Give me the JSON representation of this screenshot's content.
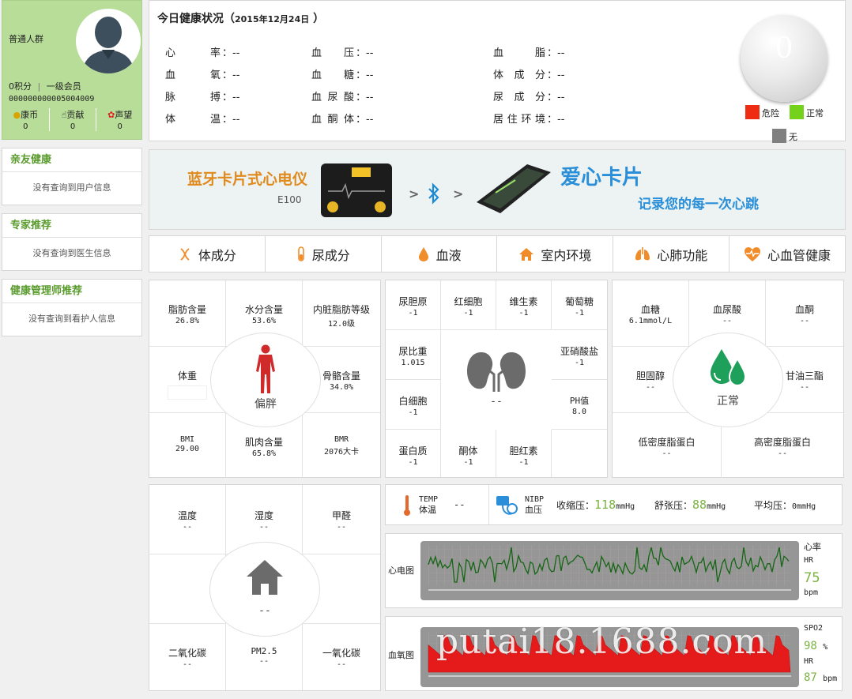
{
  "user": {
    "group": "普通人群",
    "points": "0积分",
    "level": "一级会员",
    "id": "000000000005004009",
    "stats": [
      {
        "label": "康币",
        "value": "0",
        "icon": "coin-icon"
      },
      {
        "label": "贡献",
        "value": "0",
        "icon": "hand-icon"
      },
      {
        "label": "声望",
        "value": "0",
        "icon": "ribbon-icon"
      }
    ]
  },
  "sidebar": [
    {
      "title": "亲友健康",
      "empty": "没有查询到用户信息"
    },
    {
      "title": "专家推荐",
      "empty": "没有查询到医生信息"
    },
    {
      "title": "健康管理师推荐",
      "empty": "没有查询到看护人信息"
    }
  ],
  "today": {
    "title": "今日健康状况（",
    "date": "2015年12月24日",
    "close": "）",
    "vitals": [
      {
        "label": "心率",
        "value": "--"
      },
      {
        "label": "血氧",
        "value": "--"
      },
      {
        "label": "脉搏",
        "value": "--"
      },
      {
        "label": "体温",
        "value": "--"
      },
      {
        "label": "血压",
        "value": "--"
      },
      {
        "label": "血糖",
        "value": "--"
      },
      {
        "label": "血尿酸",
        "value": "--"
      },
      {
        "label": "血酮体",
        "value": "--"
      },
      {
        "label": "血脂",
        "value": "--"
      },
      {
        "label": "体成分",
        "value": "--"
      },
      {
        "label": "尿成分",
        "value": "--"
      },
      {
        "label": "居住环境",
        "value": "--"
      }
    ],
    "sep": "：",
    "score": "0",
    "legend": [
      {
        "label": "危险",
        "color": "#ee2b13"
      },
      {
        "label": "正常",
        "color": "#74d11c"
      },
      {
        "label": "无",
        "color": "#808080"
      }
    ]
  },
  "banner": {
    "product": "蓝牙卡片式心电仪",
    "model": "E100",
    "brand": "爱心卡片",
    "slogan": "记录您的每一次心跳",
    "arrow": ">"
  },
  "tabs": [
    {
      "label": "体成分",
      "icon": "dna-icon"
    },
    {
      "label": "尿成分",
      "icon": "test-tube-icon"
    },
    {
      "label": "血液",
      "icon": "drop-icon"
    },
    {
      "label": "室内环境",
      "icon": "home-icon"
    },
    {
      "label": "心肺功能",
      "icon": "lungs-icon"
    },
    {
      "label": "心血管健康",
      "icon": "heart-pulse-icon"
    }
  ],
  "body": {
    "status": "偏胖",
    "cells": [
      {
        "name": "脂肪含量",
        "value": "26.8%"
      },
      {
        "name": "水分含量",
        "value": "53.6%"
      },
      {
        "name": "内脏脂肪等级",
        "value": "12.0级"
      },
      {
        "name": "体重",
        "value": ""
      },
      {
        "name": "骨骼含量",
        "value": "34.0%"
      },
      {
        "name": "BMI",
        "value": "29.00"
      },
      {
        "name": "肌肉含量",
        "value": "65.8%"
      },
      {
        "name": "BMR",
        "value": "2076大卡"
      }
    ]
  },
  "urine": {
    "status": "--",
    "cells": [
      {
        "name": "尿胆原",
        "value": "-1"
      },
      {
        "name": "红细胞",
        "value": "-1"
      },
      {
        "name": "维生素",
        "value": "-1"
      },
      {
        "name": "葡萄糖",
        "value": "-1"
      },
      {
        "name": "尿比重",
        "value": "1.015"
      },
      {
        "name": "亚硝酸盐",
        "value": "-1"
      },
      {
        "name": "白细胞",
        "value": "-1"
      },
      {
        "name": "PH值",
        "value": "8.0"
      },
      {
        "name": "蛋白质",
        "value": "-1"
      },
      {
        "name": "酮体",
        "value": "-1"
      },
      {
        "name": "胆红素",
        "value": "-1"
      }
    ]
  },
  "blood": {
    "status": "正常",
    "cells": [
      {
        "name": "血糖",
        "value": "6.1mmol/L"
      },
      {
        "name": "血尿酸",
        "value": "--"
      },
      {
        "name": "血酮",
        "value": "--"
      },
      {
        "name": "胆固醇",
        "value": "--"
      },
      {
        "name": "甘油三酯",
        "value": "--"
      },
      {
        "name": "低密度脂蛋白",
        "value": "--"
      },
      {
        "name": "高密度脂蛋白",
        "value": "--"
      }
    ]
  },
  "env": {
    "status": "--",
    "cells": [
      {
        "name": "温度",
        "value": "--"
      },
      {
        "name": "湿度",
        "value": "--"
      },
      {
        "name": "甲醛",
        "value": "--"
      },
      {
        "name": "二氧化碳",
        "value": "--"
      },
      {
        "name": "PM2.5",
        "value": "--"
      },
      {
        "name": "一氧化碳",
        "value": "--"
      }
    ]
  },
  "vitalsbar": {
    "temp_en": "TEMP",
    "temp_cn": "体温",
    "temp_value": "--",
    "nibp_en": "NIBP",
    "nibp_cn": "血压",
    "sys_label": "收缩压：",
    "sys_value": "118",
    "dia_label": "舒张压：",
    "dia_value": "88",
    "unit": "mmHg",
    "avg_label": "平均压：",
    "avg_value": "0mmHg"
  },
  "ecg": {
    "label": "心电图",
    "side_title": "心率",
    "hr_label": "HR",
    "hr_value": "75",
    "hr_unit": "bpm"
  },
  "spo2": {
    "label": "血氧图",
    "side_title": "SPO2",
    "spo2_value": "98",
    "spo2_unit": "%",
    "hr_label": "HR",
    "hr_value": "87",
    "hr_unit": "bpm",
    "watermark": "putai18.1688.com"
  }
}
